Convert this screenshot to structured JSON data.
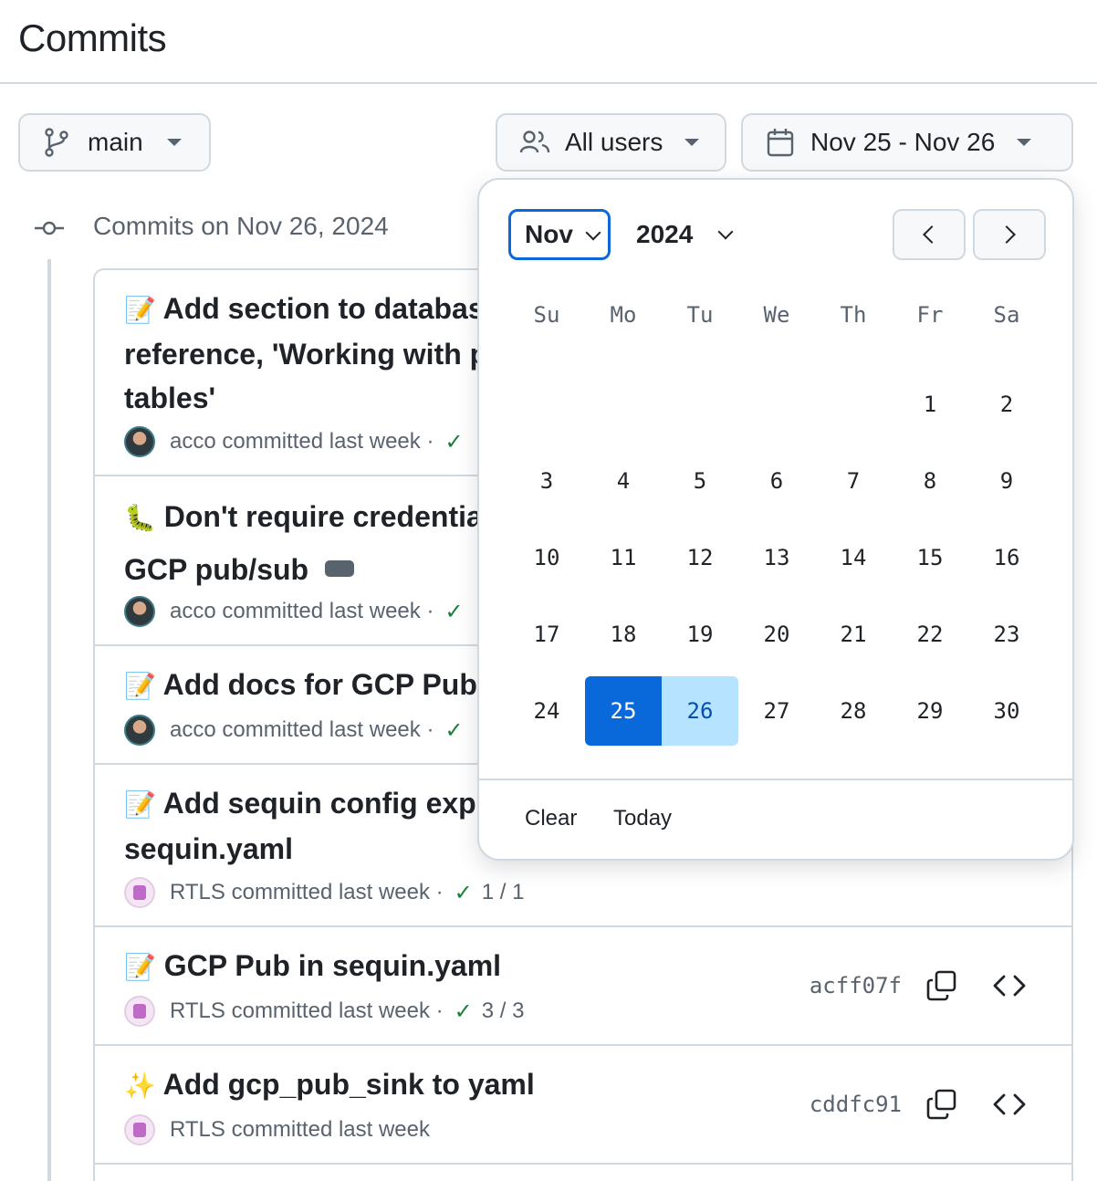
{
  "header": {
    "title": "Commits"
  },
  "filters": {
    "branch": {
      "label": "main",
      "icon": "git-branch-icon"
    },
    "users": {
      "label": "All users",
      "icon": "people-icon"
    },
    "date": {
      "label": "Nov 25 - Nov 26",
      "icon": "calendar-icon"
    }
  },
  "group": {
    "title": "Commits on Nov 26, 2024"
  },
  "commits": [
    {
      "emoji": "📝",
      "title_lines": [
        "Add section to database",
        "reference, 'Working with p",
        "tables'"
      ],
      "author": "acco",
      "meta": "committed last week",
      "sep": "·",
      "check": "✓",
      "checks": ""
    },
    {
      "emoji": "🐛",
      "title_lines": [
        "Don't require credential",
        "GCP pub/sub"
      ],
      "author": "acco",
      "meta": "committed last week",
      "sep": "·",
      "check": "✓",
      "checks": ""
    },
    {
      "emoji": "📝",
      "title_lines": [
        "Add docs for GCP Pub/S"
      ],
      "author": "acco",
      "meta": "committed last week",
      "sep": "·",
      "check": "✓",
      "checks": ""
    },
    {
      "emoji": "📝",
      "title_lines": [
        "Add sequin config expo",
        "sequin.yaml"
      ],
      "author": "RTLS",
      "meta": "committed last week",
      "sep": "·",
      "check": "✓",
      "checks": "1 / 1"
    },
    {
      "emoji": "📝",
      "title_lines": [
        "GCP Pub in sequin.yaml"
      ],
      "author": "RTLS",
      "meta": "committed last week",
      "sep": "·",
      "check": "✓",
      "checks": "3 / 3",
      "sha": "acff07f"
    },
    {
      "emoji": "✨",
      "title_lines": [
        "Add gcp_pub_sink to yaml"
      ],
      "author": "RTLS",
      "meta": "committed last week",
      "sha": "cddfc91"
    }
  ],
  "datepicker": {
    "month": "Nov",
    "year": "2024",
    "weekdays": [
      "Su",
      "Mo",
      "Tu",
      "We",
      "Th",
      "Fr",
      "Sa"
    ],
    "days": [
      "",
      "",
      "",
      "",
      "",
      "1",
      "2",
      "3",
      "4",
      "5",
      "6",
      "7",
      "8",
      "9",
      "10",
      "11",
      "12",
      "13",
      "14",
      "15",
      "16",
      "17",
      "18",
      "19",
      "20",
      "21",
      "22",
      "23",
      "24",
      "25",
      "26",
      "27",
      "28",
      "29",
      "30"
    ],
    "range_start": "25",
    "range_end": "26",
    "clear_label": "Clear",
    "today_label": "Today"
  },
  "colors": {
    "accent": "#0969da",
    "range_light": "#b6e3ff",
    "success": "#1a7f37",
    "border": "#d1d9e0"
  }
}
